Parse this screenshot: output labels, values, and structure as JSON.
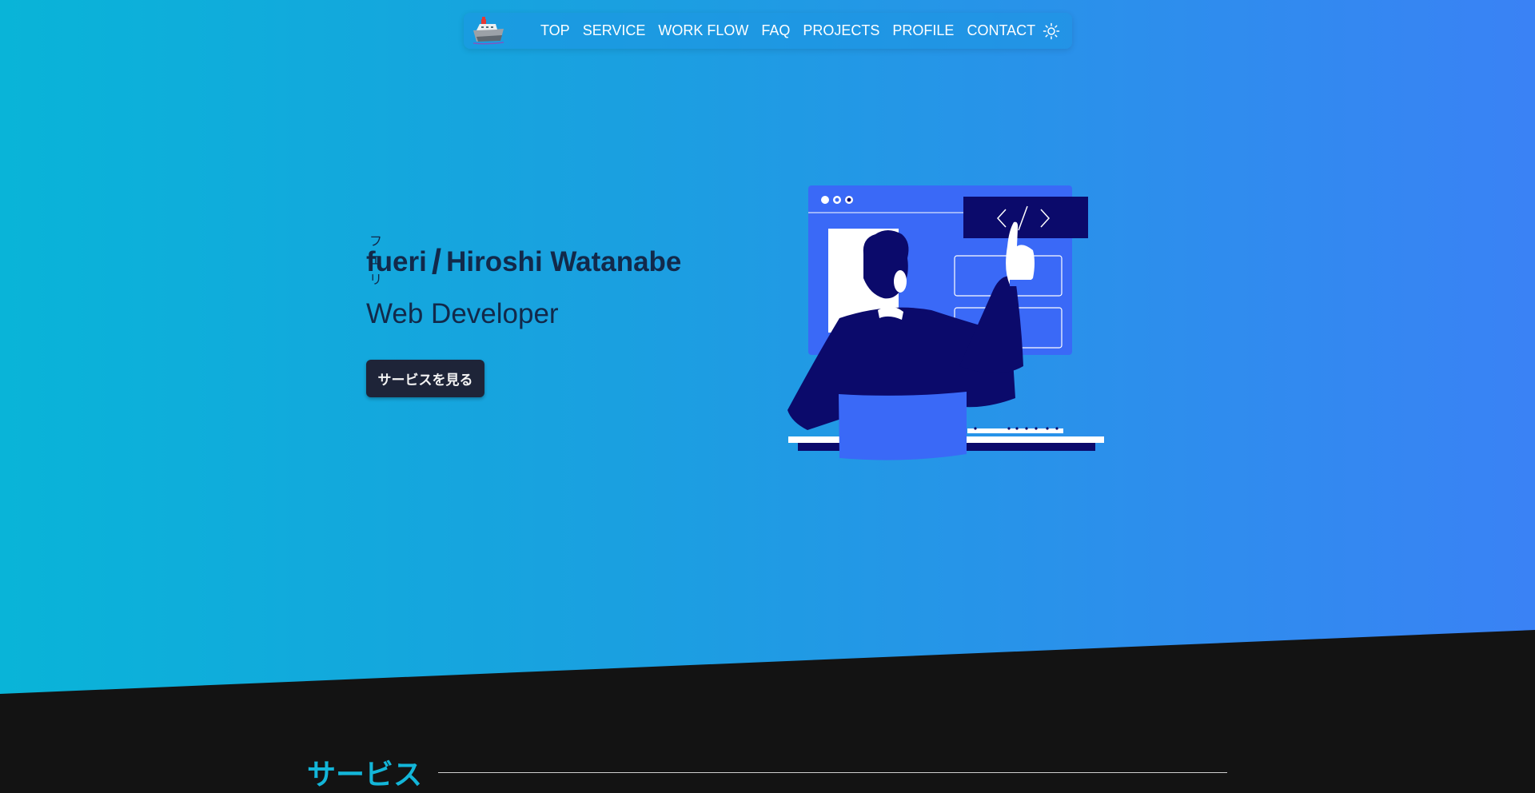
{
  "nav": {
    "logo_icon": "ship-logo-icon",
    "items": [
      {
        "label": "TOP"
      },
      {
        "label": "SERVICE"
      },
      {
        "label": "WORK FLOW"
      },
      {
        "label": "FAQ"
      },
      {
        "label": "PROJECTS"
      },
      {
        "label": "PROFILE"
      },
      {
        "label": "CONTACT"
      }
    ],
    "theme_icon": "sun-icon"
  },
  "hero": {
    "ruby": "フエリ",
    "name_main": "fueri",
    "slash": "/",
    "name_sub": "Hiroshi Watanabe",
    "subtitle": "Web Developer",
    "cta_label": "サービスを見る",
    "illustration": "developer-at-screen-illustration",
    "gradient_start": "#09b4d8",
    "gradient_end": "#3a82f5"
  },
  "section": {
    "title": "サービス",
    "title_color": "#13b6d9"
  },
  "colors": {
    "text_dark": "#12294a",
    "button_bg": "#1e2438",
    "footer_bg": "#131313"
  }
}
